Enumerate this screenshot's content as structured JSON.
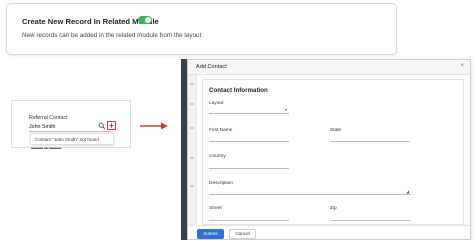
{
  "settings": {
    "title": "Create New Record In Related Module",
    "toggle_on": true,
    "toggle_color": "#2fb55d",
    "description": "New records can be added in the related module from the layout"
  },
  "lookup": {
    "label": "Referral Contact",
    "value": "John Smith",
    "search_icon": "search-icon",
    "add_icon": "add-icon",
    "dropdown_message": "Contact \"John Smith\" not found"
  },
  "modal": {
    "title": "Add Contact",
    "close_symbol": "×",
    "section_title": "Contact Information",
    "fields": {
      "layout": "Layout",
      "first_name": "First Name",
      "state": "State",
      "country": "Country",
      "description": "Description",
      "street": "Street",
      "zip": "Zip"
    },
    "buttons": {
      "submit": "Submit",
      "cancel": "Cancel"
    },
    "accent_color": "#2f6fd6"
  },
  "arrow_color": "#d23b3b"
}
